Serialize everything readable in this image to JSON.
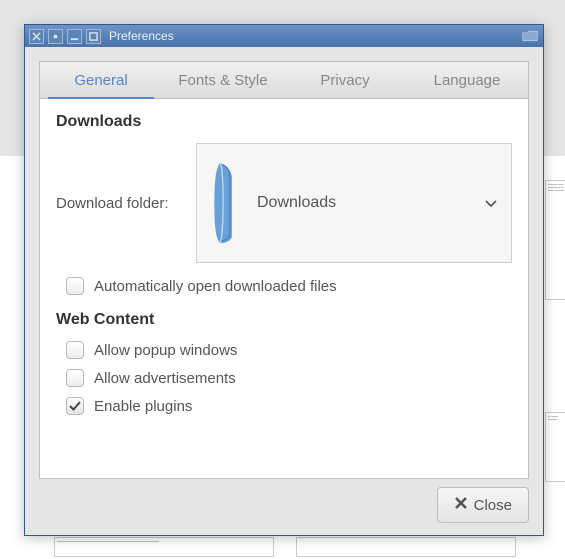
{
  "window": {
    "title": "Preferences"
  },
  "tabs": {
    "general": "General",
    "fonts": "Fonts & Style",
    "privacy": "Privacy",
    "language": "Language"
  },
  "sections": {
    "downloads": {
      "heading": "Downloads",
      "folder_label": "Download folder:",
      "folder_value": "Downloads",
      "auto_open": {
        "label": "Automatically open downloaded files",
        "checked": false
      }
    },
    "web_content": {
      "heading": "Web Content",
      "allow_popups": {
        "label": "Allow popup windows",
        "checked": false
      },
      "allow_ads": {
        "label": "Allow advertisements",
        "checked": false
      },
      "enable_plugins": {
        "label": "Enable plugins",
        "checked": true
      }
    }
  },
  "footer": {
    "close_label": "Close"
  }
}
